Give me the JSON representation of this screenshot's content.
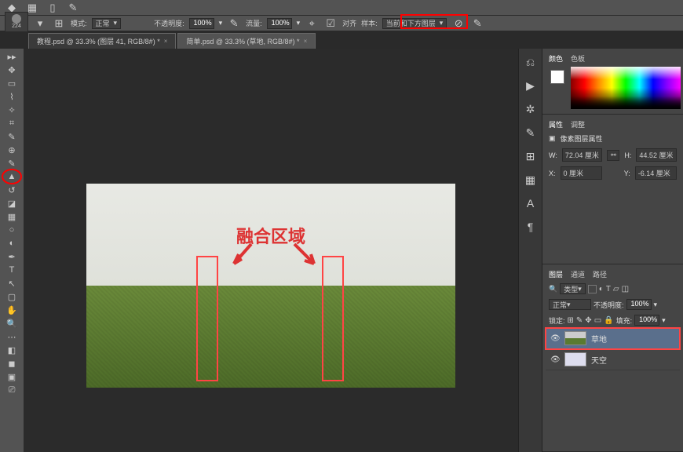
{
  "menubar": {
    "ps_logo": "Ps"
  },
  "options": {
    "brush_size": "224",
    "mode_label": "模式:",
    "mode_value": "正常",
    "opacity_label": "不透明度:",
    "opacity_value": "100%",
    "flow_label": "流量:",
    "flow_value": "100%",
    "align_label": "对齐",
    "sample_label": "样本:",
    "sample_value": "当前和下方图层"
  },
  "tabs": [
    {
      "label": "教程.psd @ 33.3% (图层 41, RGB/8#) *"
    },
    {
      "label": "简单.psd @ 33.3% (草地, RGB/8#) *"
    }
  ],
  "annotation": {
    "text": "融合区域"
  },
  "color_panel": {
    "tab1": "颜色",
    "tab2": "色板"
  },
  "properties": {
    "tab1": "属性",
    "tab2": "调整",
    "title": "像素图层属性",
    "w_label": "W:",
    "w_value": "72.04 厘米",
    "h_label": "H:",
    "h_value": "44.52 厘米",
    "x_label": "X:",
    "x_value": "0 厘米",
    "y_label": "Y:",
    "y_value": "-6.14 厘米"
  },
  "layers_panel": {
    "tab1": "图层",
    "tab2": "通道",
    "tab3": "路径",
    "kind_label": "类型",
    "blend_mode": "正常",
    "opacity_label": "不透明度:",
    "opacity_value": "100%",
    "lock_label": "锁定:",
    "fill_label": "填充:",
    "fill_value": "100%",
    "layers": [
      {
        "name": "草地"
      },
      {
        "name": "天空"
      }
    ]
  },
  "chart_data": null
}
